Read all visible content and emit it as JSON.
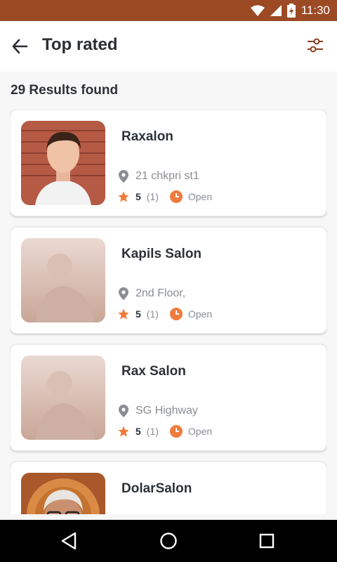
{
  "status_bar": {
    "time": "11:30"
  },
  "app_bar": {
    "title": "Top rated",
    "back_icon": "arrow-left-icon",
    "filter_icon": "sliders-icon"
  },
  "results_text": "29 Results found",
  "salons": [
    {
      "name": "Raxalon",
      "address": "21 chkpri st1",
      "rating": "5",
      "reviews": "(1)",
      "status": "Open"
    },
    {
      "name": "Kapils Salon",
      "address": "2nd Floor,",
      "rating": "5",
      "reviews": "(1)",
      "status": "Open"
    },
    {
      "name": "Rax Salon",
      "address": "SG Highway",
      "rating": "5",
      "reviews": "(1)",
      "status": "Open"
    },
    {
      "name": "DolarSalon",
      "address": "",
      "rating": "",
      "reviews": "",
      "status": ""
    }
  ],
  "colors": {
    "status_bar": "#9b4a24",
    "accent": "#ef7b3d",
    "text_dark": "#2e3138",
    "text_muted": "#8a8d93"
  }
}
